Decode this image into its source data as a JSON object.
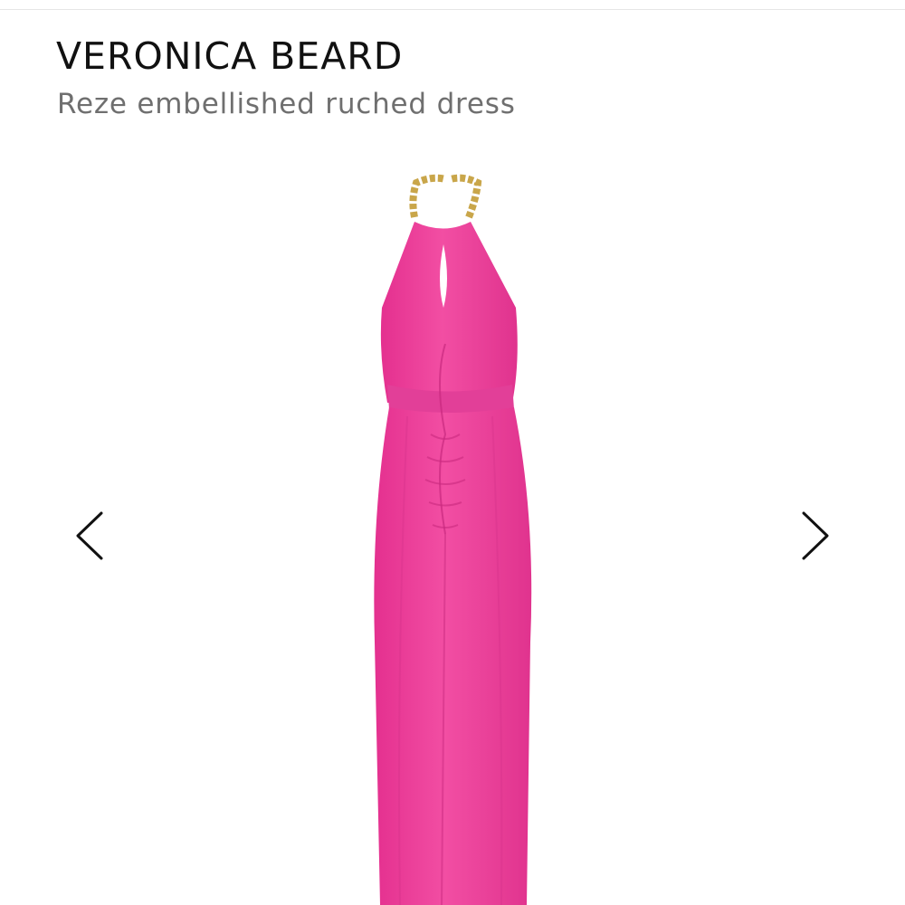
{
  "product": {
    "brand": "VERONICA BEARD",
    "name": "Reze embellished ruched dress",
    "image_alt": "Pink halter ruched maxi dress with gold chain neck"
  },
  "gallery": {
    "prev_icon": "chevron-left-icon",
    "next_icon": "chevron-right-icon"
  },
  "colors": {
    "dress": "#ef3b9a",
    "dress_shadow": "#d02a82",
    "chain": "#c9a64a",
    "text_primary": "#111111",
    "text_secondary": "#6f6f6f"
  }
}
